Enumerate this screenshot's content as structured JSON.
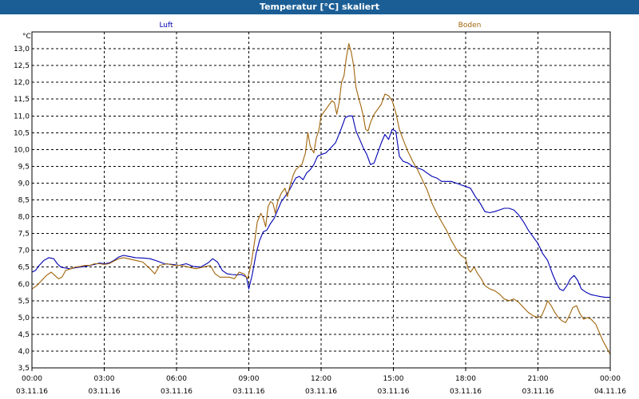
{
  "window": {
    "title": "Temperatur [°C] skaliert"
  },
  "colors": {
    "titlebar": "#1b5e96",
    "grid": "#000000",
    "background": "#ffffff"
  },
  "chart_data": {
    "type": "line",
    "title": "Temperatur [°C] skaliert",
    "ylabel": "°C",
    "xlabel": "",
    "ylim": [
      3.5,
      13.5
    ],
    "yticks": [
      3.5,
      4.0,
      4.5,
      5.0,
      5.5,
      6.0,
      6.5,
      7.0,
      7.5,
      8.0,
      8.5,
      9.0,
      9.5,
      10.0,
      10.5,
      11.0,
      11.5,
      12.0,
      12.5,
      13.0
    ],
    "ytick_labels": [
      "3,5",
      "4,0",
      "4,5",
      "5,0",
      "5,5",
      "6,0",
      "6,5",
      "7,0",
      "7,5",
      "8,0",
      "8,5",
      "9,0",
      "9,5",
      "10,0",
      "10,5",
      "11,0",
      "11,5",
      "12,0",
      "12,5",
      "13,0"
    ],
    "xlim_hours": [
      0,
      24
    ],
    "xticks": [
      {
        "hour": 0,
        "time": "00:00",
        "date": "03.11.16"
      },
      {
        "hour": 3,
        "time": "03:00",
        "date": "03.11.16"
      },
      {
        "hour": 6,
        "time": "06:00",
        "date": "03.11.16"
      },
      {
        "hour": 9,
        "time": "09:00",
        "date": "03.11.16"
      },
      {
        "hour": 12,
        "time": "12:00",
        "date": "03.11.16"
      },
      {
        "hour": 15,
        "time": "15:00",
        "date": "03.11.16"
      },
      {
        "hour": 18,
        "time": "18:00",
        "date": "03.11.16"
      },
      {
        "hour": 21,
        "time": "21:00",
        "date": "03.11.16"
      },
      {
        "hour": 24,
        "time": "00:00",
        "date": "04.11.16"
      }
    ],
    "grid": true,
    "legend_placement": "top",
    "series": [
      {
        "name": "Luft",
        "color": "#0000b4",
        "points": [
          [
            0.0,
            6.35
          ],
          [
            0.15,
            6.4
          ],
          [
            0.3,
            6.55
          ],
          [
            0.5,
            6.7
          ],
          [
            0.7,
            6.78
          ],
          [
            0.9,
            6.75
          ],
          [
            1.05,
            6.6
          ],
          [
            1.2,
            6.5
          ],
          [
            1.4,
            6.47
          ],
          [
            1.6,
            6.45
          ],
          [
            1.8,
            6.48
          ],
          [
            2.0,
            6.5
          ],
          [
            2.2,
            6.52
          ],
          [
            2.4,
            6.55
          ],
          [
            2.6,
            6.58
          ],
          [
            2.8,
            6.62
          ],
          [
            3.0,
            6.6
          ],
          [
            3.2,
            6.62
          ],
          [
            3.4,
            6.7
          ],
          [
            3.6,
            6.8
          ],
          [
            3.8,
            6.85
          ],
          [
            4.0,
            6.82
          ],
          [
            4.3,
            6.78
          ],
          [
            4.6,
            6.77
          ],
          [
            4.9,
            6.75
          ],
          [
            5.2,
            6.68
          ],
          [
            5.5,
            6.6
          ],
          [
            5.8,
            6.58
          ],
          [
            6.1,
            6.55
          ],
          [
            6.4,
            6.6
          ],
          [
            6.7,
            6.52
          ],
          [
            7.0,
            6.5
          ],
          [
            7.3,
            6.62
          ],
          [
            7.5,
            6.75
          ],
          [
            7.7,
            6.65
          ],
          [
            7.9,
            6.4
          ],
          [
            8.1,
            6.3
          ],
          [
            8.3,
            6.28
          ],
          [
            8.5,
            6.27
          ],
          [
            8.7,
            6.28
          ],
          [
            8.9,
            6.2
          ],
          [
            9.0,
            5.85
          ],
          [
            9.15,
            6.3
          ],
          [
            9.3,
            6.9
          ],
          [
            9.45,
            7.3
          ],
          [
            9.6,
            7.55
          ],
          [
            9.75,
            7.6
          ],
          [
            9.9,
            7.8
          ],
          [
            10.05,
            7.95
          ],
          [
            10.2,
            8.2
          ],
          [
            10.35,
            8.45
          ],
          [
            10.5,
            8.6
          ],
          [
            10.65,
            8.75
          ],
          [
            10.8,
            8.95
          ],
          [
            10.95,
            9.15
          ],
          [
            11.1,
            9.2
          ],
          [
            11.25,
            9.1
          ],
          [
            11.4,
            9.3
          ],
          [
            11.55,
            9.4
          ],
          [
            11.7,
            9.55
          ],
          [
            11.85,
            9.8
          ],
          [
            12.0,
            9.85
          ],
          [
            12.2,
            9.9
          ],
          [
            12.4,
            10.05
          ],
          [
            12.6,
            10.2
          ],
          [
            12.8,
            10.55
          ],
          [
            13.0,
            10.95
          ],
          [
            13.15,
            11.0
          ],
          [
            13.3,
            11.0
          ],
          [
            13.45,
            10.55
          ],
          [
            13.6,
            10.3
          ],
          [
            13.75,
            10.05
          ],
          [
            13.9,
            9.85
          ],
          [
            14.05,
            9.55
          ],
          [
            14.2,
            9.6
          ],
          [
            14.35,
            9.9
          ],
          [
            14.5,
            10.2
          ],
          [
            14.65,
            10.45
          ],
          [
            14.8,
            10.3
          ],
          [
            14.95,
            10.6
          ],
          [
            15.1,
            10.55
          ],
          [
            15.25,
            9.8
          ],
          [
            15.4,
            9.65
          ],
          [
            15.6,
            9.6
          ],
          [
            15.8,
            9.5
          ],
          [
            16.0,
            9.45
          ],
          [
            16.2,
            9.4
          ],
          [
            16.4,
            9.3
          ],
          [
            16.6,
            9.2
          ],
          [
            16.8,
            9.15
          ],
          [
            17.0,
            9.05
          ],
          [
            17.2,
            9.05
          ],
          [
            17.4,
            9.05
          ],
          [
            17.6,
            9.0
          ],
          [
            17.8,
            8.95
          ],
          [
            18.0,
            8.9
          ],
          [
            18.2,
            8.85
          ],
          [
            18.4,
            8.6
          ],
          [
            18.6,
            8.4
          ],
          [
            18.8,
            8.15
          ],
          [
            19.0,
            8.12
          ],
          [
            19.2,
            8.15
          ],
          [
            19.4,
            8.2
          ],
          [
            19.6,
            8.25
          ],
          [
            19.8,
            8.25
          ],
          [
            20.0,
            8.2
          ],
          [
            20.2,
            8.05
          ],
          [
            20.4,
            7.85
          ],
          [
            20.6,
            7.6
          ],
          [
            20.8,
            7.4
          ],
          [
            21.0,
            7.2
          ],
          [
            21.2,
            6.9
          ],
          [
            21.4,
            6.7
          ],
          [
            21.6,
            6.3
          ],
          [
            21.75,
            6.05
          ],
          [
            21.9,
            5.85
          ],
          [
            22.05,
            5.8
          ],
          [
            22.2,
            5.95
          ],
          [
            22.35,
            6.15
          ],
          [
            22.5,
            6.25
          ],
          [
            22.65,
            6.1
          ],
          [
            22.8,
            5.85
          ],
          [
            23.0,
            5.75
          ],
          [
            23.2,
            5.68
          ],
          [
            23.4,
            5.65
          ],
          [
            23.6,
            5.62
          ],
          [
            23.8,
            5.6
          ],
          [
            24.0,
            5.6
          ]
        ]
      },
      {
        "name": "Boden",
        "color": "#a0640a",
        "points": [
          [
            0.0,
            5.85
          ],
          [
            0.2,
            5.95
          ],
          [
            0.4,
            6.1
          ],
          [
            0.6,
            6.25
          ],
          [
            0.8,
            6.35
          ],
          [
            0.95,
            6.25
          ],
          [
            1.1,
            6.15
          ],
          [
            1.25,
            6.2
          ],
          [
            1.4,
            6.4
          ],
          [
            1.6,
            6.45
          ],
          [
            1.8,
            6.5
          ],
          [
            2.0,
            6.52
          ],
          [
            2.2,
            6.55
          ],
          [
            2.4,
            6.55
          ],
          [
            2.6,
            6.6
          ],
          [
            2.8,
            6.6
          ],
          [
            3.0,
            6.58
          ],
          [
            3.2,
            6.6
          ],
          [
            3.4,
            6.68
          ],
          [
            3.6,
            6.75
          ],
          [
            3.8,
            6.78
          ],
          [
            4.0,
            6.75
          ],
          [
            4.3,
            6.7
          ],
          [
            4.6,
            6.65
          ],
          [
            4.9,
            6.45
          ],
          [
            5.1,
            6.3
          ],
          [
            5.3,
            6.55
          ],
          [
            5.6,
            6.6
          ],
          [
            5.9,
            6.55
          ],
          [
            6.2,
            6.55
          ],
          [
            6.5,
            6.5
          ],
          [
            6.8,
            6.45
          ],
          [
            7.1,
            6.5
          ],
          [
            7.4,
            6.55
          ],
          [
            7.6,
            6.3
          ],
          [
            7.8,
            6.2
          ],
          [
            8.0,
            6.2
          ],
          [
            8.2,
            6.2
          ],
          [
            8.4,
            6.15
          ],
          [
            8.6,
            6.35
          ],
          [
            8.8,
            6.3
          ],
          [
            8.95,
            6.15
          ],
          [
            9.1,
            6.6
          ],
          [
            9.25,
            7.3
          ],
          [
            9.35,
            7.85
          ],
          [
            9.5,
            8.1
          ],
          [
            9.6,
            7.95
          ],
          [
            9.7,
            7.7
          ],
          [
            9.8,
            8.3
          ],
          [
            9.9,
            8.45
          ],
          [
            10.0,
            8.4
          ],
          [
            10.1,
            8.1
          ],
          [
            10.2,
            8.45
          ],
          [
            10.35,
            8.7
          ],
          [
            10.5,
            8.85
          ],
          [
            10.6,
            8.6
          ],
          [
            10.7,
            8.9
          ],
          [
            10.85,
            9.25
          ],
          [
            10.95,
            9.4
          ],
          [
            11.1,
            9.5
          ],
          [
            11.2,
            9.55
          ],
          [
            11.35,
            9.9
          ],
          [
            11.45,
            10.5
          ],
          [
            11.55,
            10.1
          ],
          [
            11.7,
            9.9
          ],
          [
            11.8,
            10.35
          ],
          [
            11.9,
            10.55
          ],
          [
            12.0,
            11.0
          ],
          [
            12.15,
            11.15
          ],
          [
            12.3,
            11.3
          ],
          [
            12.45,
            11.45
          ],
          [
            12.55,
            11.4
          ],
          [
            12.65,
            11.05
          ],
          [
            12.75,
            11.4
          ],
          [
            12.85,
            12.0
          ],
          [
            12.95,
            12.2
          ],
          [
            13.05,
            12.75
          ],
          [
            13.15,
            13.15
          ],
          [
            13.25,
            12.9
          ],
          [
            13.35,
            12.5
          ],
          [
            13.45,
            11.85
          ],
          [
            13.55,
            11.55
          ],
          [
            13.65,
            11.3
          ],
          [
            13.75,
            11.0
          ],
          [
            13.85,
            10.6
          ],
          [
            13.95,
            10.55
          ],
          [
            14.05,
            10.8
          ],
          [
            14.2,
            11.05
          ],
          [
            14.35,
            11.2
          ],
          [
            14.5,
            11.35
          ],
          [
            14.65,
            11.65
          ],
          [
            14.8,
            11.6
          ],
          [
            14.95,
            11.45
          ],
          [
            15.1,
            11.1
          ],
          [
            15.25,
            10.6
          ],
          [
            15.4,
            10.3
          ],
          [
            15.6,
            9.95
          ],
          [
            15.8,
            9.65
          ],
          [
            16.0,
            9.4
          ],
          [
            16.2,
            9.1
          ],
          [
            16.4,
            8.8
          ],
          [
            16.6,
            8.4
          ],
          [
            16.8,
            8.1
          ],
          [
            17.0,
            7.85
          ],
          [
            17.2,
            7.6
          ],
          [
            17.4,
            7.3
          ],
          [
            17.6,
            7.05
          ],
          [
            17.8,
            6.85
          ],
          [
            18.0,
            6.75
          ],
          [
            18.1,
            6.45
          ],
          [
            18.2,
            6.35
          ],
          [
            18.35,
            6.5
          ],
          [
            18.5,
            6.3
          ],
          [
            18.65,
            6.15
          ],
          [
            18.8,
            5.95
          ],
          [
            19.0,
            5.85
          ],
          [
            19.2,
            5.8
          ],
          [
            19.4,
            5.7
          ],
          [
            19.6,
            5.55
          ],
          [
            19.8,
            5.5
          ],
          [
            20.0,
            5.55
          ],
          [
            20.2,
            5.45
          ],
          [
            20.4,
            5.3
          ],
          [
            20.6,
            5.15
          ],
          [
            20.8,
            5.05
          ],
          [
            21.0,
            5.0
          ],
          [
            21.15,
            5.05
          ],
          [
            21.3,
            5.3
          ],
          [
            21.4,
            5.5
          ],
          [
            21.55,
            5.35
          ],
          [
            21.7,
            5.15
          ],
          [
            21.85,
            5.0
          ],
          [
            22.0,
            4.9
          ],
          [
            22.15,
            4.85
          ],
          [
            22.3,
            5.05
          ],
          [
            22.45,
            5.3
          ],
          [
            22.6,
            5.35
          ],
          [
            22.75,
            5.1
          ],
          [
            22.9,
            4.95
          ],
          [
            23.05,
            5.0
          ],
          [
            23.2,
            4.95
          ],
          [
            23.4,
            4.8
          ],
          [
            23.55,
            4.55
          ],
          [
            23.7,
            4.3
          ],
          [
            23.85,
            4.1
          ],
          [
            24.0,
            3.9
          ]
        ]
      }
    ]
  }
}
